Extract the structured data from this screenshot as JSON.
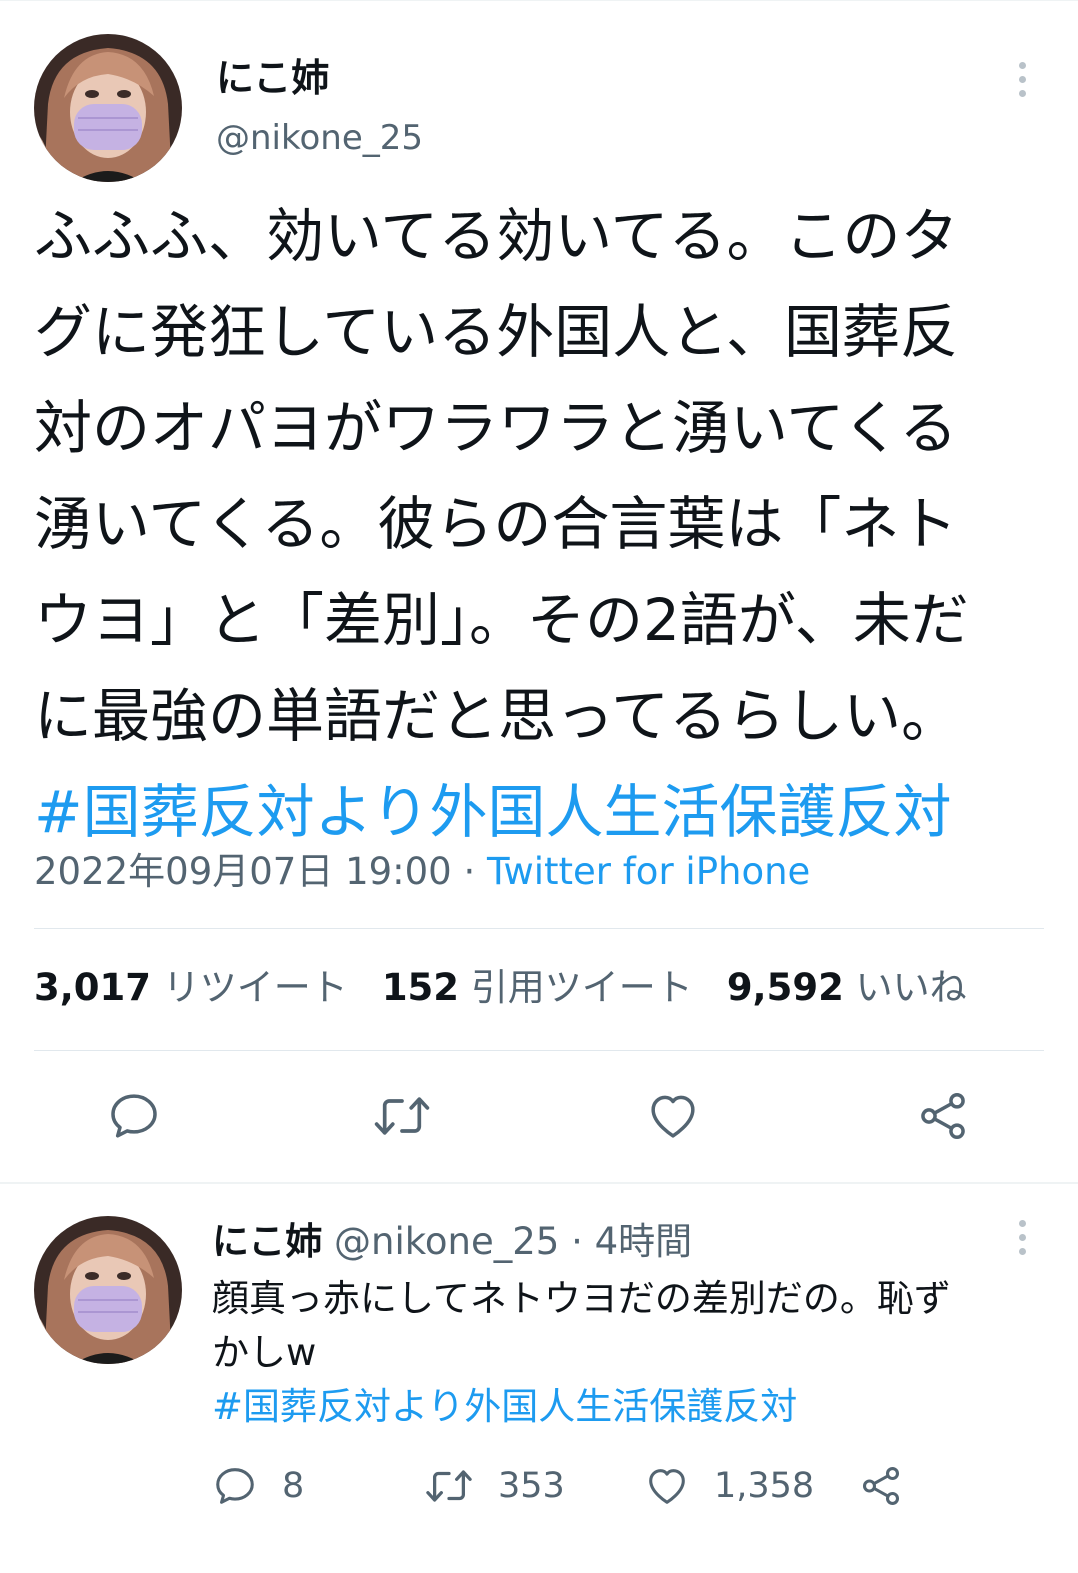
{
  "main_tweet": {
    "display_name": "にこ姉",
    "handle": "@nikone_25",
    "body_lines": [
      "ふふふ、効いてる効いてる。このタ",
      "グに発狂している外国人と、国葬反",
      "対のオパヨがワラワラと湧いてくる",
      "湧いてくる。彼らの合言葉は「ネト",
      "ウヨ」と「差別」。その2語が、未だ",
      "に最強の単語だと思ってるらしい。"
    ],
    "hashtag": "#国葬反対より外国人生活保護反対",
    "timestamp": "2022年09月07日 19:00",
    "separator": " · ",
    "source": "Twitter for iPhone",
    "stats": {
      "retweets": "3,017",
      "retweets_label": "リツイート",
      "quotes": "152",
      "quotes_label": "引用ツイート",
      "likes": "9,592",
      "likes_label": "いいね"
    }
  },
  "reply_tweet": {
    "display_name": "にこ姉",
    "handle_time": "@nikone_25 · 4時間",
    "body_lines": [
      "顔真っ赤にしてネトウヨだの差別だの。恥ず",
      "かしw"
    ],
    "hashtag": "#国葬反対より外国人生活保護反対",
    "counts": {
      "reply": "8",
      "retweet": "353",
      "like": "1,358"
    }
  },
  "icons": {
    "reply": "reply-icon",
    "retweet": "retweet-icon",
    "like": "heart-icon",
    "share": "share-icon",
    "more": "more-vertical-icon"
  },
  "colors": {
    "link": "#1d9bf0",
    "secondary_text": "#536471",
    "icon": "#536471"
  }
}
